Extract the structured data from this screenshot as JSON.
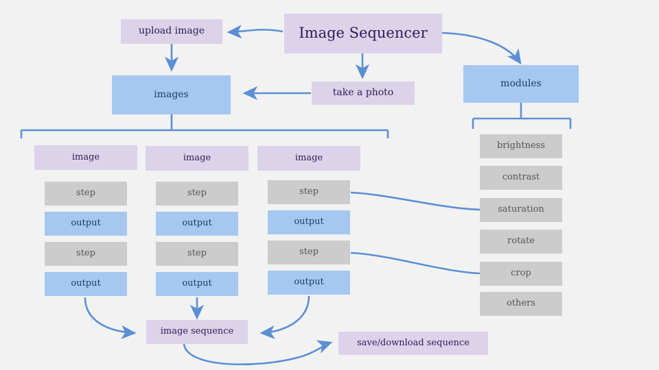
{
  "diagram": {
    "title": "Image Sequencer",
    "background_color": "#f2f2f2",
    "colors": {
      "purple_fill": "#dcd3ea",
      "purple_text": "#2d1b57",
      "blue_fill": "#a6c8f0",
      "blue_text": "#1b3a6b",
      "gray_fill": "#cccccc",
      "gray_text": "#555555",
      "edge": "#5b8fd4"
    }
  },
  "nodes": {
    "root": {
      "label": "Image Sequencer"
    },
    "upload_image": {
      "label": "upload image"
    },
    "take_a_photo": {
      "label": "take a photo"
    },
    "images": {
      "label": "images"
    },
    "modules": {
      "label": "modules"
    },
    "image_sequence": {
      "label": "image sequence"
    },
    "save_download": {
      "label": "save/download sequence"
    }
  },
  "columns": [
    {
      "image_label": "image",
      "steps": [
        {
          "label": "step"
        },
        {
          "label": "output"
        },
        {
          "label": "step"
        },
        {
          "label": "output"
        }
      ]
    },
    {
      "image_label": "image",
      "steps": [
        {
          "label": "step"
        },
        {
          "label": "output"
        },
        {
          "label": "step"
        },
        {
          "label": "output"
        }
      ]
    },
    {
      "image_label": "image",
      "steps": [
        {
          "label": "step"
        },
        {
          "label": "output"
        },
        {
          "label": "step"
        },
        {
          "label": "output"
        }
      ]
    }
  ],
  "modules_list": [
    {
      "label": "brightness"
    },
    {
      "label": "contrast"
    },
    {
      "label": "saturation"
    },
    {
      "label": "rotate"
    },
    {
      "label": "crop"
    },
    {
      "label": "others"
    }
  ]
}
